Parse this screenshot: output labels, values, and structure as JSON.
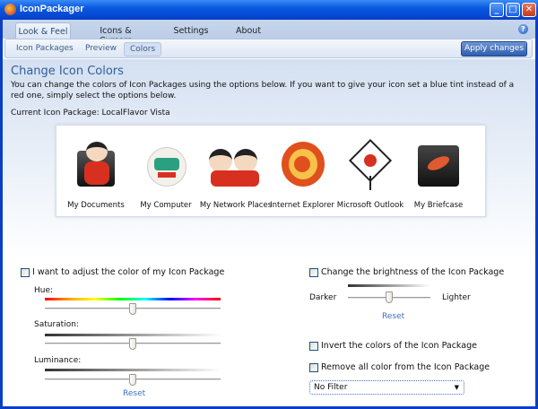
{
  "window": {
    "title": "IconPackager",
    "minimize": "_",
    "maximize": "□",
    "close": "✕"
  },
  "tabs": [
    {
      "label": "Look & Feel",
      "active": true
    },
    {
      "label": "Icons & Cursors"
    },
    {
      "label": "Settings"
    },
    {
      "label": "About"
    }
  ],
  "help": "?",
  "subtabs": [
    {
      "label": "Icon Packages"
    },
    {
      "label": "Preview"
    },
    {
      "label": "Colors",
      "active": true
    }
  ],
  "apply_label": "Apply changes",
  "page": {
    "title": "Change Icon Colors",
    "description": "You can change the colors of Icon Packages using the options below. If you want to give your icon set a blue tint instead of a red one, simply select the options below.",
    "current": "Current Icon Package: LocalFlavor Vista"
  },
  "icons": [
    {
      "label": "My Documents"
    },
    {
      "label": "My Computer"
    },
    {
      "label": "My Network Places"
    },
    {
      "label": "Internet Explorer"
    },
    {
      "label": "Microsoft Outlook"
    },
    {
      "label": "My Briefcase"
    }
  ],
  "left": {
    "checkbox": "I want to adjust the color of my Icon Package",
    "checked": false,
    "hue_label": "Hue:",
    "hue": 0.5,
    "saturation_label": "Saturation:",
    "saturation": 0.5,
    "luminance_label": "Luminance:",
    "luminance": 0.5,
    "reset": "Reset"
  },
  "right": {
    "brightness_checkbox": "Change the brightness of the Icon Package",
    "darker": "Darker",
    "lighter": "Lighter",
    "brightness": 0.5,
    "reset": "Reset",
    "invert_checkbox": "Invert the colors of the Icon Package",
    "remove_checkbox": "Remove all color from the Icon Package",
    "filter_value": "No Filter"
  }
}
